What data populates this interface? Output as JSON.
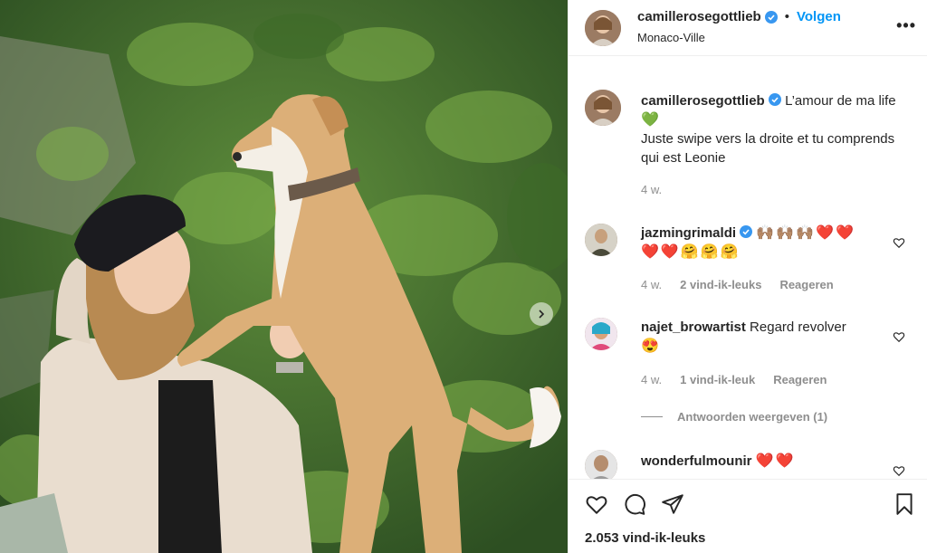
{
  "post": {
    "author": "camillerosegottlieb",
    "follow_label": "Volgen",
    "separator": "•",
    "location": "Monaco-Ville",
    "more_label": "•••"
  },
  "caption": {
    "user": "camillerosegottlieb",
    "text_line1": "L’amour de ma life",
    "text_rest": "Juste swipe vers la droite et tu comprends qui est Leonie",
    "time": "4 w."
  },
  "comments": [
    {
      "user": "jazmingrimaldi",
      "emojis": [
        "🙌🏽",
        "🙌🏽",
        "🙌🏽",
        "❤️",
        "❤️",
        "❤️",
        "❤️",
        "🤗",
        "🤗",
        "🤗"
      ],
      "time": "4 w.",
      "likes": "2 vind-ik-leuks",
      "reply": "Reageren"
    },
    {
      "user": "najet_browartist",
      "text": "Regard revolver",
      "emojis": [
        "😍"
      ],
      "time": "4 w.",
      "likes": "1 vind-ik-leuk",
      "reply": "Reageren"
    },
    {
      "user": "wonderfulmounir",
      "emojis": [
        "❤️",
        "❤️"
      ]
    }
  ],
  "view_replies": "Antwoorden weergeven (1)",
  "likes_count": "2.053 vind-ik-leuks",
  "colors": {
    "accent": "#0095f6",
    "verified": "#3897f0",
    "muted": "#8e8e8e",
    "heart": "#ed4956"
  }
}
